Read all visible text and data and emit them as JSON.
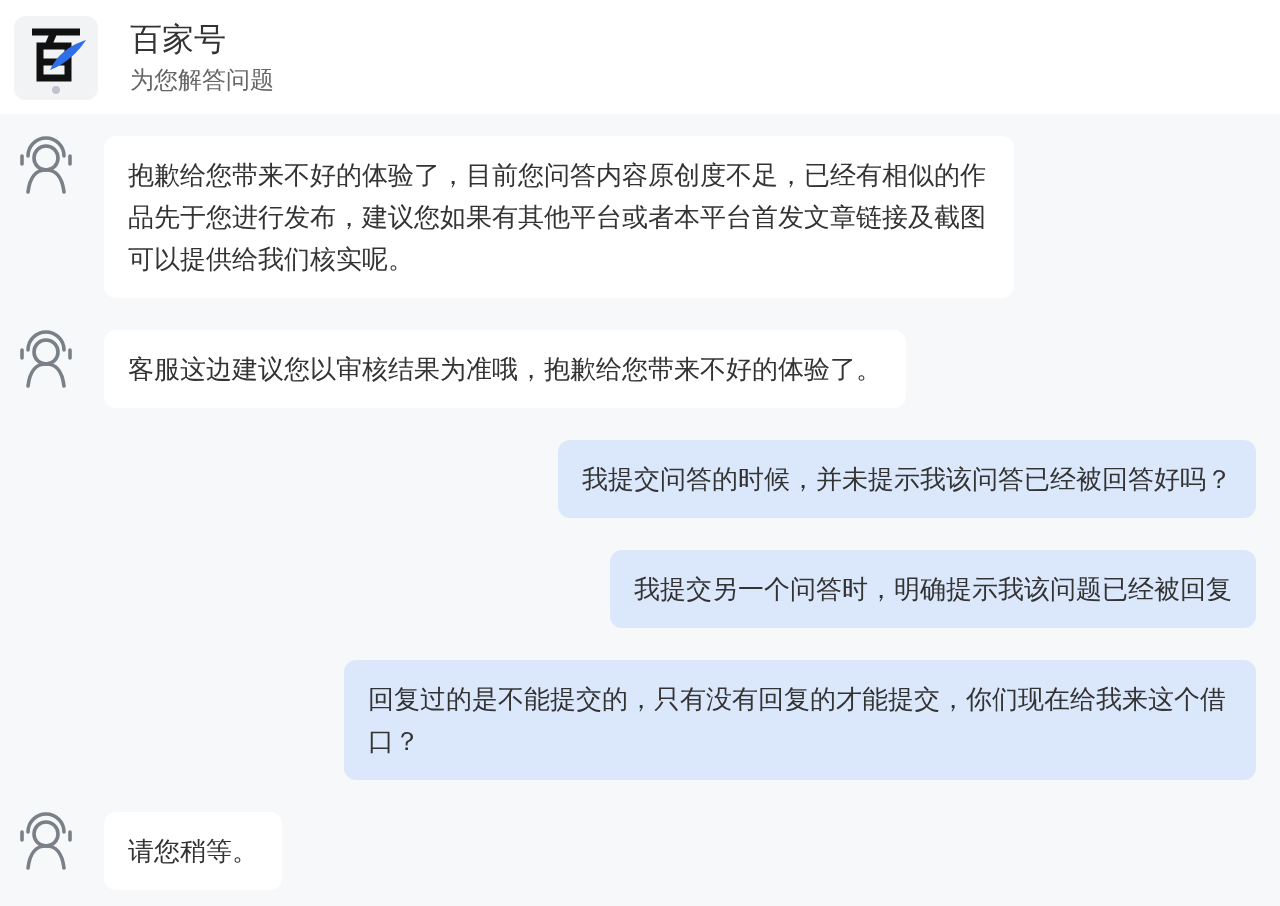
{
  "header": {
    "title": "百家号",
    "subtitle": "为您解答问题"
  },
  "messages": [
    {
      "kind": "agent",
      "text": "抱歉给您带来不好的体验了，目前您问答内容原创度不足，已经有相似的作品先于您进行发布，建议您如果有其他平台或者本平台首发文章链接及截图可以提供给我们核实呢。"
    },
    {
      "kind": "agent",
      "text": "客服这边建议您以审核结果为准哦，抱歉给您带来不好的体验了。"
    },
    {
      "kind": "user",
      "text": "我提交问答的时候，并未提示我该问答已经被回答好吗？"
    },
    {
      "kind": "user",
      "text": "我提交另一个问答时，明确提示我该问题已经被回复"
    },
    {
      "kind": "user",
      "text": "回复过的是不能提交的，只有没有回复的才能提交，你们现在给我来这个借口？"
    },
    {
      "kind": "agent",
      "text": "请您稍等。"
    }
  ]
}
